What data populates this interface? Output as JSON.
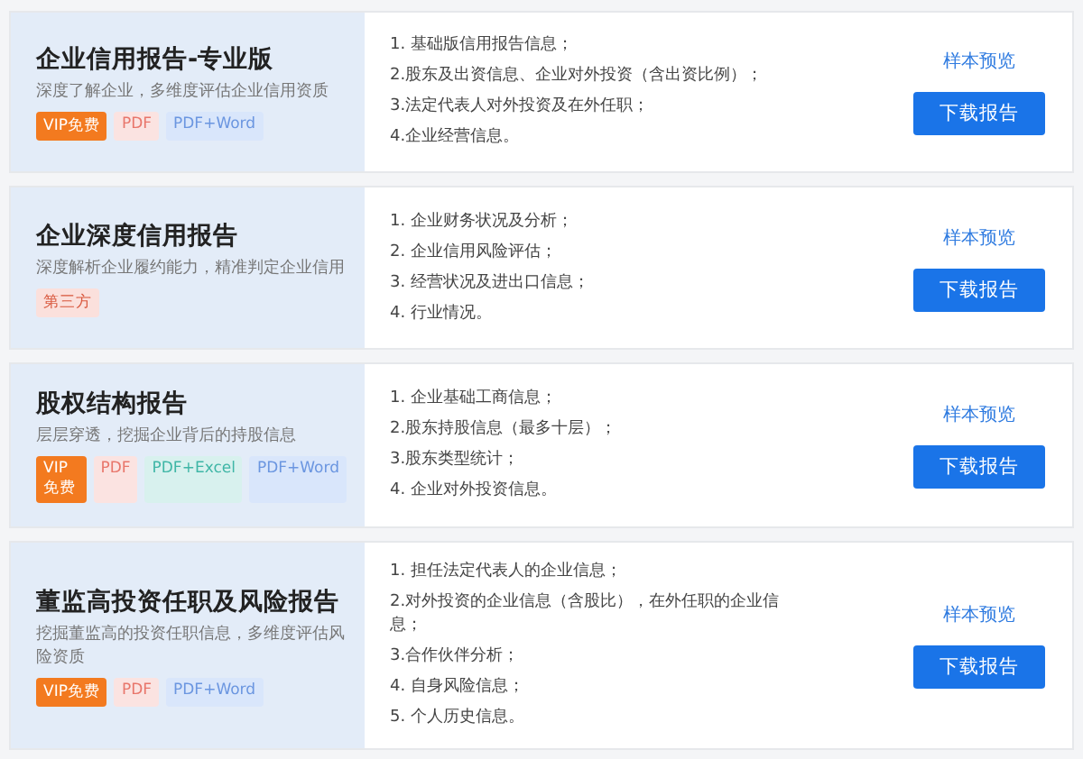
{
  "reports": [
    {
      "title": "企业信用报告-专业版",
      "subtitle": "深度了解企业，多维度评估企业信用资质",
      "tags": [
        {
          "label": "VIP免费",
          "kind": "vip"
        },
        {
          "label": "PDF",
          "kind": "pdf"
        },
        {
          "label": "PDF+Word",
          "kind": "word"
        }
      ],
      "items": [
        "1. 基础版信用报告信息；",
        "2.股东及出资信息、企业对外投资（含出资比例）；",
        "3.法定代表人对外投资及在外任职；",
        "4.企业经营信息。"
      ],
      "preview": "样本预览",
      "download": "下载报告"
    },
    {
      "title": "企业深度信用报告",
      "subtitle": "深度解析企业履约能力，精准判定企业信用",
      "tags": [
        {
          "label": "第三方",
          "kind": "third"
        }
      ],
      "items": [
        "1. 企业财务状况及分析；",
        "2. 企业信用风险评估；",
        "3. 经营状况及进出口信息；",
        "4. 行业情况。"
      ],
      "preview": "样本预览",
      "download": "下载报告"
    },
    {
      "title": "股权结构报告",
      "subtitle": "层层穿透，挖掘企业背后的持股信息",
      "tags": [
        {
          "label": "VIP免费",
          "kind": "vip"
        },
        {
          "label": "PDF",
          "kind": "pdf"
        },
        {
          "label": "PDF+Excel",
          "kind": "excel"
        },
        {
          "label": "PDF+Word",
          "kind": "word"
        }
      ],
      "items": [
        "1. 企业基础工商信息；",
        "2.股东持股信息（最多十层）；",
        "3.股东类型统计；",
        "4. 企业对外投资信息。"
      ],
      "preview": "样本预览",
      "download": "下载报告"
    },
    {
      "title": "董监高投资任职及风险报告",
      "subtitle": "挖掘董监高的投资任职信息，多维度评估风险资质",
      "tags": [
        {
          "label": "VIP免费",
          "kind": "vip"
        },
        {
          "label": "PDF",
          "kind": "pdf"
        },
        {
          "label": "PDF+Word",
          "kind": "word"
        }
      ],
      "items": [
        "1. 担任法定代表人的企业信息；",
        "2.对外投资的企业信息（含股比），在外任职的企业信息；",
        "3.合作伙伴分析；",
        "4. 自身风险信息；",
        "5. 个人历史信息。"
      ],
      "preview": "样本预览",
      "download": "下载报告"
    }
  ]
}
